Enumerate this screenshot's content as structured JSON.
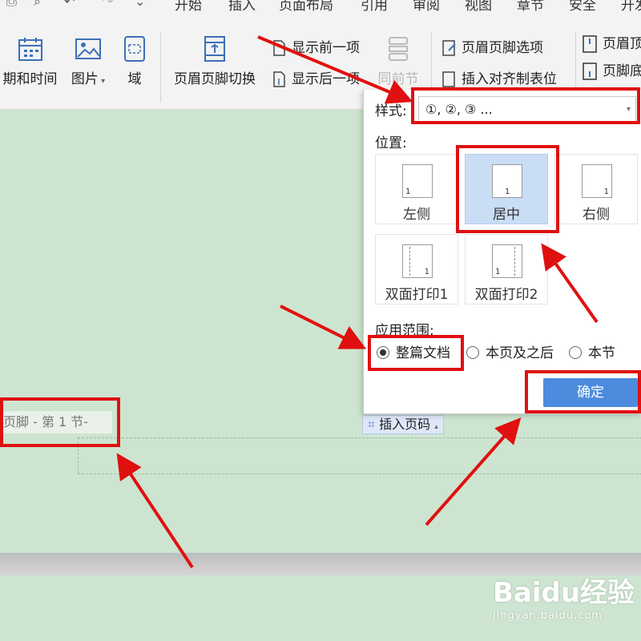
{
  "menubar": {
    "items": [
      "开始",
      "插入",
      "页面布局",
      "引用",
      "审阅",
      "视图",
      "章节",
      "安全",
      "开发"
    ]
  },
  "ribbon": {
    "date_time": "期和时间",
    "picture": "图片",
    "field": "域",
    "header_footer_switch": "页眉页脚切换",
    "show_prev": "显示前一项",
    "show_next": "显示后一项",
    "same_as_prev": "同前节",
    "header_footer_options": "页眉页脚选项",
    "insert_align_tab": "插入对齐制表位",
    "header_top": "页眉顶",
    "footer_bottom": "页脚底"
  },
  "document": {
    "footer_label": "页脚  - 第 1 节-",
    "insert_page_number": "插入页码"
  },
  "panel": {
    "style_label": "样式:",
    "style_value": "①, ②, ③ ...",
    "position_label": "位置:",
    "positions": [
      "左侧",
      "居中",
      "右侧",
      "双面打印1",
      "双面打印2"
    ],
    "selected_position": "居中",
    "thumb_number": "1",
    "scope_label": "应用范围:",
    "scopes": [
      "整篇文档",
      "本页及之后",
      "本节"
    ],
    "selected_scope": "整篇文档",
    "ok": "确定"
  },
  "watermark": {
    "logo": "Baidu经验",
    "url": "jingyan.baidu.com"
  },
  "colors": {
    "doc_background": "#cde5d0",
    "annotation_red": "#e01010",
    "ok_button": "#4c8bdd",
    "selected_card": "#c9ddf5"
  }
}
